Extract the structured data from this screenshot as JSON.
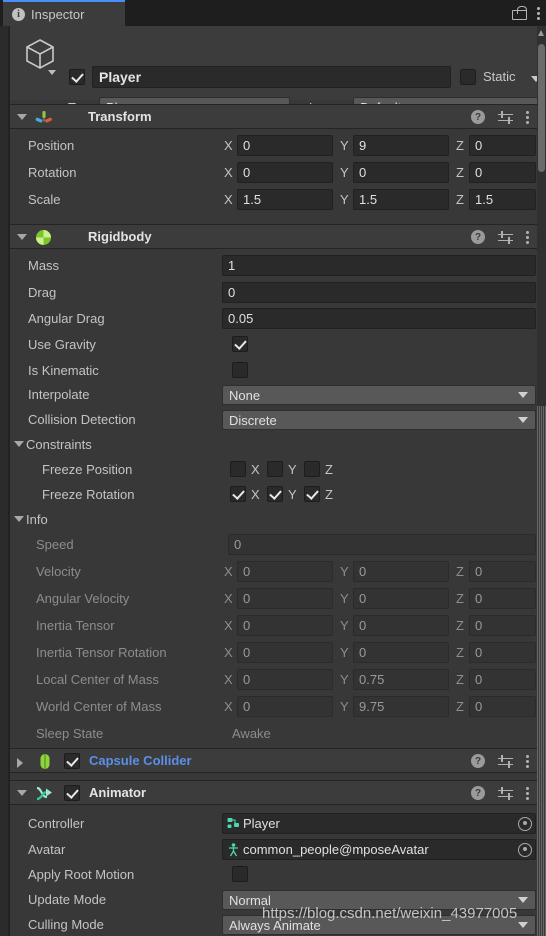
{
  "window": {
    "tab_label": "Inspector",
    "tab_icon": "info-icon",
    "lock_icon": "lock-icon",
    "menu_icon": "kebab-menu-icon",
    "accent_color": "#4a8ff7",
    "background_color": "#383838"
  },
  "gameobject": {
    "icon": "cube-icon",
    "enabled": true,
    "name": "Player",
    "static_checked": false,
    "static_label": "Static",
    "tag_label": "Tag",
    "tag_value": "Player",
    "layer_label": "Layer",
    "layer_value": "Default"
  },
  "components": [
    {
      "name": "Transform",
      "icon": "transform-gizmo-icon",
      "expanded": true,
      "has_enable_checkbox": false,
      "rows": [
        {
          "label": "Position",
          "x": "0",
          "y": "9",
          "z": "0"
        },
        {
          "label": "Rotation",
          "x": "0",
          "y": "0",
          "z": "0"
        },
        {
          "label": "Scale",
          "x": "1.5",
          "y": "1.5",
          "z": "1.5"
        }
      ]
    },
    {
      "name": "Rigidbody",
      "icon": "rigidbody-icon",
      "expanded": true,
      "has_enable_checkbox": false,
      "fields": {
        "mass_label": "Mass",
        "mass_value": "1",
        "drag_label": "Drag",
        "drag_value": "0",
        "angular_drag_label": "Angular Drag",
        "angular_drag_value": "0.05",
        "use_gravity_label": "Use Gravity",
        "use_gravity_checked": true,
        "is_kinematic_label": "Is Kinematic",
        "is_kinematic_checked": false,
        "interpolate_label": "Interpolate",
        "interpolate_value": "None",
        "collision_detection_label": "Collision Detection",
        "collision_detection_value": "Discrete",
        "constraints_label": "Constraints",
        "freeze_position_label": "Freeze Position",
        "freeze_position": {
          "x": false,
          "y": false,
          "z": false
        },
        "freeze_rotation_label": "Freeze Rotation",
        "freeze_rotation": {
          "x": true,
          "y": true,
          "z": true
        },
        "info_label": "Info",
        "speed_label": "Speed",
        "speed_value": "0",
        "velocity_label": "Velocity",
        "velocity": {
          "x": "0",
          "y": "0",
          "z": "0"
        },
        "angular_velocity_label": "Angular Velocity",
        "angular_velocity": {
          "x": "0",
          "y": "0",
          "z": "0"
        },
        "inertia_tensor_label": "Inertia Tensor",
        "inertia_tensor": {
          "x": "0",
          "y": "0",
          "z": "0"
        },
        "inertia_tensor_rotation_label": "Inertia Tensor Rotation",
        "inertia_tensor_rotation": {
          "x": "0",
          "y": "0",
          "z": "0"
        },
        "local_center_label": "Local Center of Mass",
        "local_center": {
          "x": "0",
          "y": "0.75",
          "z": "0"
        },
        "world_center_label": "World Center of Mass",
        "world_center": {
          "x": "0",
          "y": "9.75",
          "z": "0"
        },
        "sleep_state_label": "Sleep State",
        "sleep_state_value": "Awake"
      }
    },
    {
      "name": "Capsule Collider",
      "icon": "capsule-collider-icon",
      "expanded": false,
      "has_enable_checkbox": true,
      "enabled": true
    },
    {
      "name": "Animator",
      "icon": "animator-icon",
      "expanded": true,
      "has_enable_checkbox": true,
      "enabled": true,
      "fields": {
        "controller_label": "Controller",
        "controller_value": "Player",
        "controller_icon": "animator-controller-icon",
        "avatar_label": "Avatar",
        "avatar_value": "common_people@mposeAvatar",
        "avatar_icon": "avatar-icon",
        "apply_root_motion_label": "Apply Root Motion",
        "apply_root_motion_checked": false,
        "update_mode_label": "Update Mode",
        "update_mode_value": "Normal",
        "culling_mode_label": "Culling Mode",
        "culling_mode_value": "Always Animate"
      }
    }
  ],
  "header_icons": {
    "help": "?",
    "help_name": "help-icon",
    "preset": "preset-icon",
    "menu": "kebab-menu-icon"
  },
  "axis_labels": {
    "x": "X",
    "y": "Y",
    "z": "Z"
  },
  "watermark": "https://blog.csdn.net/weixin_43977005"
}
